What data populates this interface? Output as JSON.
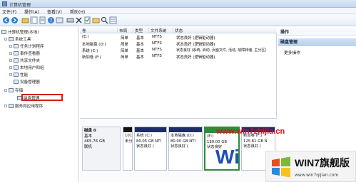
{
  "window": {
    "title": "计算机管理"
  },
  "menu": [
    "文件(F)",
    "操作(A)",
    "查看(V)",
    "帮助(H)"
  ],
  "tree": {
    "root": "计算机管理(本地)",
    "system_tools": "系统工具",
    "system_items": [
      "任务计划程序",
      "事件查看器",
      "共享文件夹",
      "本地用户和组",
      "性能",
      "设备管理器"
    ],
    "storage": "存储",
    "disk_management": "磁盘管理",
    "services": "服务和应用程序"
  },
  "volumes": {
    "headers": [
      "卷",
      "布局",
      "类型",
      "文件系统",
      "状态"
    ],
    "rows": [
      [
        "(E:)",
        "简单",
        "基本",
        "NTFS",
        "状态良好 (逻辑驱动器)"
      ],
      [
        "本地磁盘 (D:)",
        "简单",
        "基本",
        "NTFS",
        "状态良好 (逻辑驱动器)"
      ],
      [
        "系统 (C:)",
        "简单",
        "基本",
        "NTFS",
        "状态良好 (系统, 启动, 页面文件, 活动, 故障转储, 主分区)"
      ],
      [
        "新加卷 (F:)",
        "简单",
        "基本",
        "NTFS",
        "状态良好 (逻辑驱动器)"
      ]
    ]
  },
  "disk": {
    "name": "磁盘 0",
    "type": "基本",
    "size": "465.76 GB",
    "status": "联机",
    "partitions": [
      {
        "l1": "",
        "l2": "101",
        "l3": "未分"
      },
      {
        "l1": "系统 (C:)",
        "l2": "80.05 GB NTI",
        "l3": "状态良好 ("
      },
      {
        "l1": "本地磁盘 (D:)",
        "l2": "80.00 GB NTI",
        "l3": "状态良好 ("
      },
      {
        "l1": "(E:)",
        "l2": "180.00 GB",
        "l3": "状态良好"
      },
      {
        "l1": "新加卷 (F:)",
        "l2": "125.61 GB N",
        "l3": "状态良好 ("
      }
    ]
  },
  "actions": {
    "header": "操作",
    "section": "磁盘管理",
    "more": "更多操作"
  },
  "watermark": {
    "url": "www.win7zhijia.cn",
    "brand": "WIN7旗舰版",
    "brand_url": "www.win7qijian.com",
    "big": "Wi"
  },
  "colors": {
    "partition_bar": "#1c2d68",
    "highlight": "#d21c1c"
  }
}
